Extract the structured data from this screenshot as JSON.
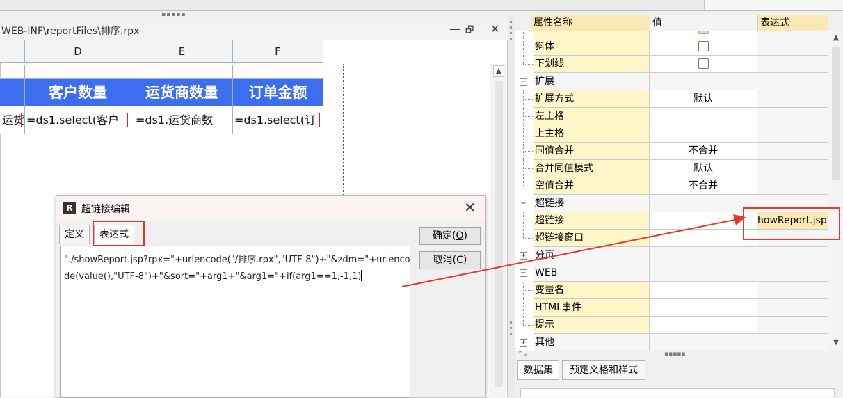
{
  "editor": {
    "title": "WEB-INF\\reportFiles\\排序.rpx",
    "controls": [
      "—",
      "🗗",
      "✕"
    ],
    "columns": [
      "D",
      "E",
      "F"
    ],
    "header_cells": [
      "客户数量",
      "运货商数量",
      "订单金额"
    ],
    "formula_cells": [
      "运货",
      "=ds1.select(客户",
      "=ds1.运货商数",
      "=ds1.select(订"
    ]
  },
  "dialog": {
    "title": "超链接编辑",
    "tabs": [
      "定义",
      "表达式"
    ],
    "expression": "\"./showReport.jsp?rpx=\"+urlencode(\"/排序.rpx\",\"UTF-8\")+\"&zdm=\"+urlencode(value(),\"UTF-8\")+\"&sort=\"+arg1+\"&arg1=\"+if(arg1==1,-1,1)",
    "ok_label": "确定(O)",
    "cancel_label": "取消(C)",
    "ok_key": "O",
    "cancel_key": "C"
  },
  "props": {
    "headers": [
      "属性名称",
      "值",
      "表达式"
    ],
    "rows": [
      {
        "name": "斜体",
        "value": "",
        "expr": ""
      },
      {
        "name": "下划线",
        "value": "",
        "expr": ""
      },
      {
        "name": "扩展",
        "value": "",
        "expr": ""
      },
      {
        "name": "扩展方式",
        "value": "默认",
        "expr": ""
      },
      {
        "name": "左主格",
        "value": "",
        "expr": ""
      },
      {
        "name": "上主格",
        "value": "",
        "expr": ""
      },
      {
        "name": "同值合并",
        "value": "不合并",
        "expr": ""
      },
      {
        "name": "合并同值模式",
        "value": "默认",
        "expr": ""
      },
      {
        "name": "空值合并",
        "value": "不合并",
        "expr": ""
      },
      {
        "name": "超链接",
        "value": "",
        "expr": ""
      },
      {
        "name": "超链接",
        "value": "",
        "expr": "howReport.jsp?"
      },
      {
        "name": "超链接窗口",
        "value": "",
        "expr": ""
      },
      {
        "name": "分页",
        "value": "",
        "expr": ""
      },
      {
        "name": "WEB",
        "value": "",
        "expr": ""
      },
      {
        "name": "变量名",
        "value": "",
        "expr": ""
      },
      {
        "name": "HTML事件",
        "value": "",
        "expr": ""
      },
      {
        "name": "提示",
        "value": "",
        "expr": ""
      },
      {
        "name": "其他",
        "value": "",
        "expr": ""
      }
    ],
    "bottom_tabs": [
      "数据集",
      "预定义格和样式"
    ]
  },
  "colors": {
    "header_blue": "#3d6ef0",
    "annotation_red": "#e53a2b",
    "prop_yellow": "#fff6c9"
  }
}
